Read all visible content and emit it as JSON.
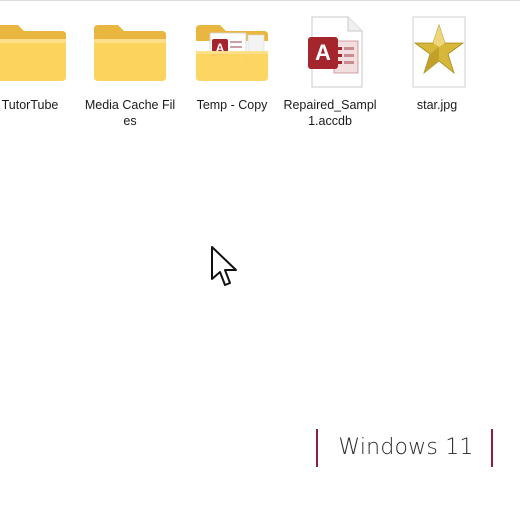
{
  "files": [
    {
      "name": "TutorTube",
      "type": "folder"
    },
    {
      "name": "Media Cache Files",
      "type": "folder"
    },
    {
      "name": "Temp - Copy",
      "type": "folder-with-content"
    },
    {
      "name": "Repaired_Sampl1.accdb",
      "type": "access-database"
    },
    {
      "name": "star.jpg",
      "type": "image"
    }
  ],
  "access_icon_letter": "A",
  "watermark": "Windows 11",
  "colors": {
    "folder_front": "#fcd35c",
    "folder_back": "#e9b740",
    "access_red": "#a4262c",
    "star_gold": "#d6b73a",
    "watermark_bar": "#8a1f4a"
  }
}
